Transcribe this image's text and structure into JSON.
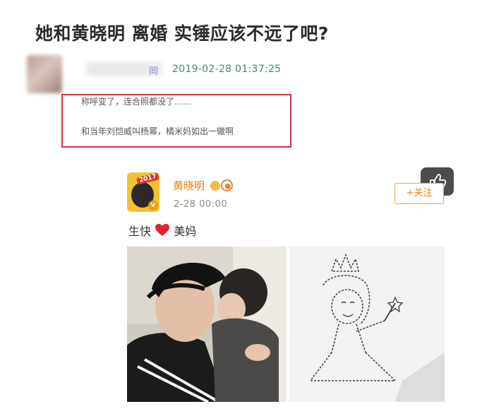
{
  "article": {
    "title": "她和黄晓明 离婚 实锤应该不远了吧?"
  },
  "comment": {
    "name_tail": "同",
    "timestamp": "2019-02-28 01:37:25",
    "quote_line1": "称呼变了，连合照都没了……",
    "quote_line2": "和当年刘恺威叫杨幂，橘米妈如出一辙啊"
  },
  "weibo_post": {
    "avatar_badge_year": "2017",
    "author": "黄晓明",
    "time": "2-28 00:00",
    "follow_label": "+关注",
    "text_before_heart": "生快",
    "text_after_heart": "美妈",
    "verified_mark": "v"
  },
  "colors": {
    "highlight_border": "#d8333b",
    "author_name": "#e77f12",
    "timestamp": "#3f8a63",
    "follow": "#e8822a"
  },
  "icons": {
    "like": "thumbs-up-icon",
    "heart": "heart-icon",
    "verified": "verified-icon"
  }
}
